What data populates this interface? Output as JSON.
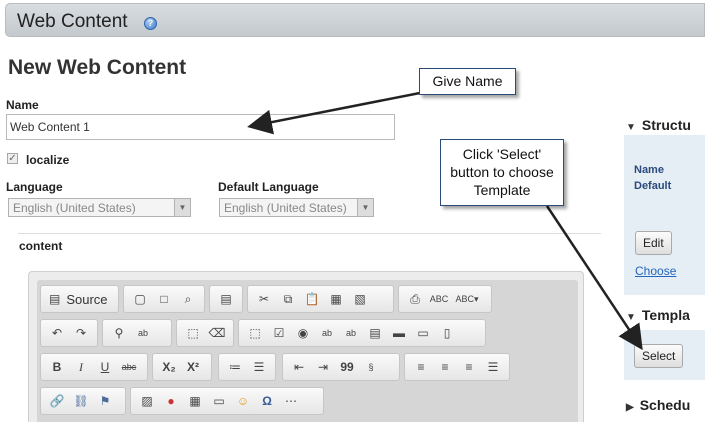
{
  "header": {
    "title": "Web Content",
    "help_icon": "help-icon"
  },
  "page_title": "New Web Content",
  "form": {
    "name_label": "Name",
    "name_value": "Web Content 1",
    "localize_label": "localize",
    "localize_checked": true,
    "language_label": "Language",
    "language_value": "English (United States)",
    "default_language_label": "Default Language",
    "default_language_value": "English (United States)",
    "content_label": "content"
  },
  "editor": {
    "source_label": "Source",
    "toolbar_icons": [
      "source-icon",
      "save-icon",
      "new-page-icon",
      "preview-icon",
      "templates-icon",
      "cut-icon",
      "copy-icon",
      "paste-icon",
      "paste-text-icon",
      "paste-word-icon",
      "print-icon",
      "spellcheck-icon",
      "scayt-icon",
      "undo-icon",
      "redo-icon",
      "find-icon",
      "replace-icon",
      "select-all-icon",
      "remove-format-icon",
      "form-icon",
      "checkbox-icon",
      "radio-icon",
      "textfield-icon",
      "textarea-icon",
      "select-icon",
      "button-icon",
      "image-button-icon",
      "hidden-field-icon",
      "bold-icon",
      "italic-icon",
      "underline-icon",
      "strike-icon",
      "subscript-icon",
      "superscript-icon",
      "numbered-list-icon",
      "bulleted-list-icon",
      "outdent-icon",
      "indent-icon",
      "blockquote-icon",
      "div-icon",
      "align-left-icon",
      "align-center-icon",
      "align-right-icon",
      "justify-icon",
      "link-icon",
      "unlink-icon",
      "anchor-icon",
      "image-icon",
      "flash-icon",
      "table-icon",
      "horizontal-rule-icon",
      "smiley-icon",
      "special-char-icon",
      "page-break-icon"
    ],
    "format_labels": {
      "subscript": "X₂",
      "superscript": "X²",
      "strike": "abc",
      "quote": "99"
    }
  },
  "right_panel": {
    "structure_header": "Structu",
    "name_label": "Name",
    "default_label": "Default",
    "edit_button": "Edit",
    "choose_link": "Choose",
    "template_header": "Templa",
    "select_button": "Select",
    "schedule_header": "Schedu"
  },
  "callouts": {
    "give_name": "Give Name",
    "select_template": [
      "Click 'Select'",
      "button to choose",
      "Template"
    ]
  },
  "colors": {
    "header_bar": "#c9cdd2",
    "panel_bg": "#e5edf5",
    "callout_border": "#2c4a78",
    "link": "#2266bb"
  }
}
